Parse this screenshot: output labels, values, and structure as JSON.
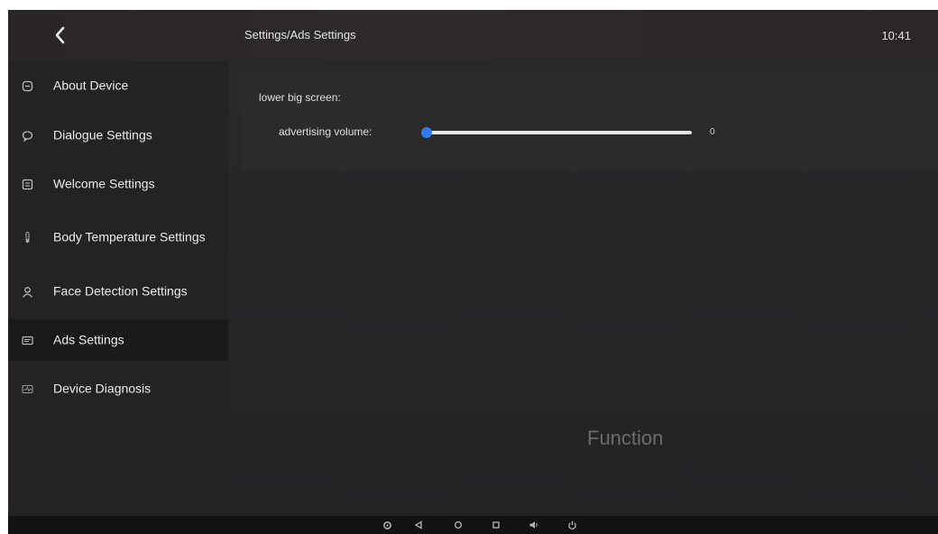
{
  "header": {
    "breadcrumb": "Settings/Ads Settings",
    "time": "10:41"
  },
  "sidebar": {
    "items": [
      {
        "label": "About Device",
        "icon": "device-info-icon"
      },
      {
        "label": "Dialogue Settings",
        "icon": "chat-icon"
      },
      {
        "label": "Welcome Settings",
        "icon": "welcome-card-icon"
      },
      {
        "label": "Body Temperature Settings",
        "icon": "thermometer-icon"
      },
      {
        "label": "Face Detection Settings",
        "icon": "person-icon"
      },
      {
        "label": "Ads Settings",
        "icon": "ads-icon",
        "selected": true
      },
      {
        "label": "Device Diagnosis",
        "icon": "diagnosis-icon"
      }
    ]
  },
  "content": {
    "section_title": "lower big screen:",
    "volume_label": "advertising volume:",
    "volume_value": "0",
    "volume_level": 0
  },
  "caption": "Function",
  "bottom_nav": {
    "buttons": [
      "settings-icon",
      "back-icon",
      "home-icon",
      "recents-icon",
      "volume-icon",
      "power-icon"
    ]
  },
  "colors": {
    "accent": "#2f7cf0",
    "background": "#1f1d1f",
    "text": "#ececec"
  }
}
